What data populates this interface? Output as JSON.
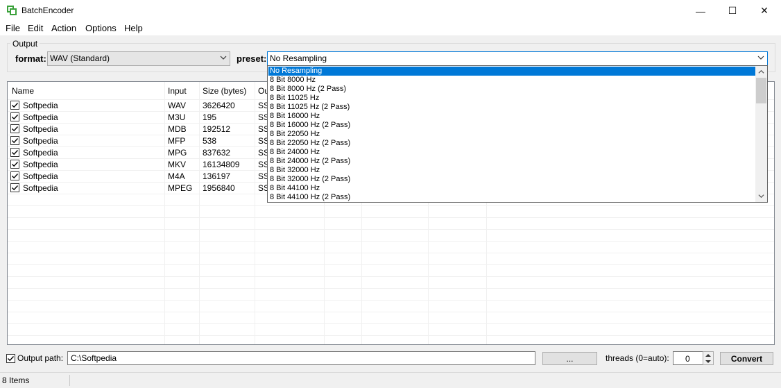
{
  "window": {
    "title": "BatchEncoder",
    "minimize_glyph": "—",
    "maximize_glyph": "☐",
    "close_glyph": "✕"
  },
  "menu": [
    "File",
    "Edit",
    "Action",
    "Options",
    "Help"
  ],
  "output": {
    "group_label": "Output",
    "format_label": "format:",
    "format_value": "WAV (Standard)",
    "preset_label": "preset:",
    "preset_value": "No Resampling"
  },
  "preset_options": [
    "No Resampling",
    "8 Bit 8000 Hz",
    "8 Bit 8000 Hz (2 Pass)",
    "8 Bit 11025 Hz",
    "8 Bit 11025 Hz (2 Pass)",
    "8 Bit 16000 Hz",
    "8 Bit 16000 Hz (2 Pass)",
    "8 Bit 22050 Hz",
    "8 Bit 22050 Hz (2 Pass)",
    "8 Bit 24000 Hz",
    "8 Bit 24000 Hz (2 Pass)",
    "8 Bit 32000 Hz",
    "8 Bit 32000 Hz (2 Pass)",
    "8 Bit 44100 Hz",
    "8 Bit 44100 Hz (2 Pass)"
  ],
  "file_list": {
    "columns": [
      "Name",
      "Input",
      "Size (bytes)",
      "Ou"
    ],
    "rows": [
      {
        "name": "Softpedia",
        "input": "WAV",
        "size": "3626420",
        "output": "SS"
      },
      {
        "name": "Softpedia",
        "input": "M3U",
        "size": "195",
        "output": "SS"
      },
      {
        "name": "Softpedia",
        "input": "MDB",
        "size": "192512",
        "output": "SS"
      },
      {
        "name": "Softpedia",
        "input": "MFP",
        "size": "538",
        "output": "SS"
      },
      {
        "name": "Softpedia",
        "input": "MPG",
        "size": "837632",
        "output": "SS"
      },
      {
        "name": "Softpedia",
        "input": "MKV",
        "size": "16134809",
        "output": "SS"
      },
      {
        "name": "Softpedia",
        "input": "M4A",
        "size": "136197",
        "output": "SS"
      },
      {
        "name": "Softpedia",
        "input": "MPEG",
        "size": "1956840",
        "output": "SS"
      }
    ]
  },
  "bottom": {
    "output_path_label": "Output path:",
    "output_path_value": "C:\\Softpedia",
    "browse_label": "...",
    "threads_label": "threads (0=auto):",
    "threads_value": "0",
    "convert_label": "Convert"
  },
  "status": {
    "items_text": "8 Items"
  },
  "colors": {
    "selection": "#0078d7",
    "list_border": "#828790"
  }
}
